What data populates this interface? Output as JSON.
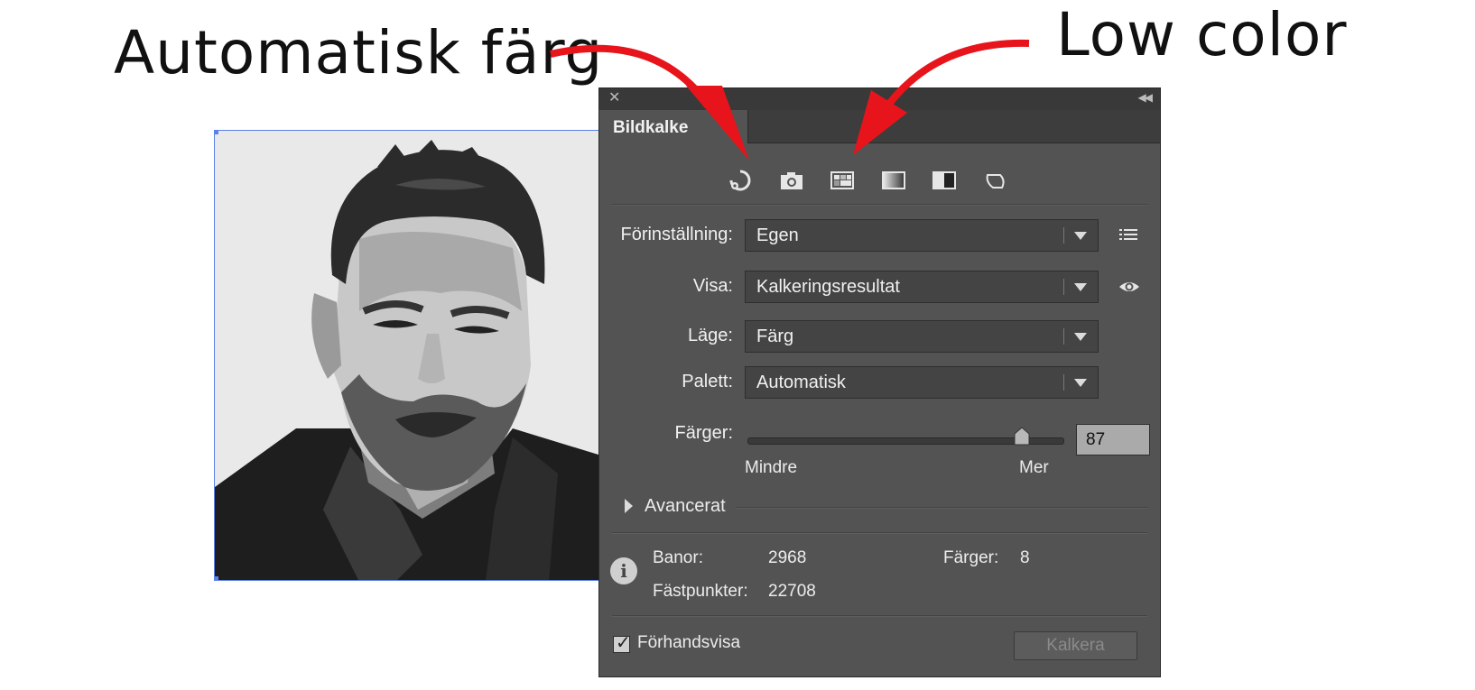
{
  "annotations": {
    "automatic_color": "Automatisk färg",
    "low_color": "Low color"
  },
  "colors": {
    "arrow": "#e8141b",
    "panel_bg": "#535353",
    "selection": "#5b82e8"
  },
  "panel": {
    "tab_title": "Bildkalke",
    "icons": [
      "auto-color-icon",
      "camera-icon",
      "low-color-icon",
      "grayscale-gradient-icon",
      "black-white-icon",
      "outline-icon"
    ],
    "preset": {
      "label": "Förinställning:",
      "value": "Egen"
    },
    "view": {
      "label": "Visa:",
      "value": "Kalkeringsresultat"
    },
    "mode": {
      "label": "Läge:",
      "value": "Färg"
    },
    "palette": {
      "label": "Palett:",
      "value": "Automatisk"
    },
    "colors_slider": {
      "label": "Färger:",
      "value": 87,
      "display": "87",
      "min": 0,
      "max": 100,
      "min_label": "Mindre",
      "max_label": "Mer"
    },
    "advanced": {
      "label": "Avancerat"
    },
    "stats": {
      "paths_label": "Banor:",
      "paths_value": "2968",
      "colors_label": "Färger:",
      "colors_value": "8",
      "anchors_label": "Fästpunkter:",
      "anchors_value": "22708"
    },
    "preview": {
      "label": "Förhandsvisa",
      "checked": true
    },
    "trace_button": "Kalkera"
  }
}
